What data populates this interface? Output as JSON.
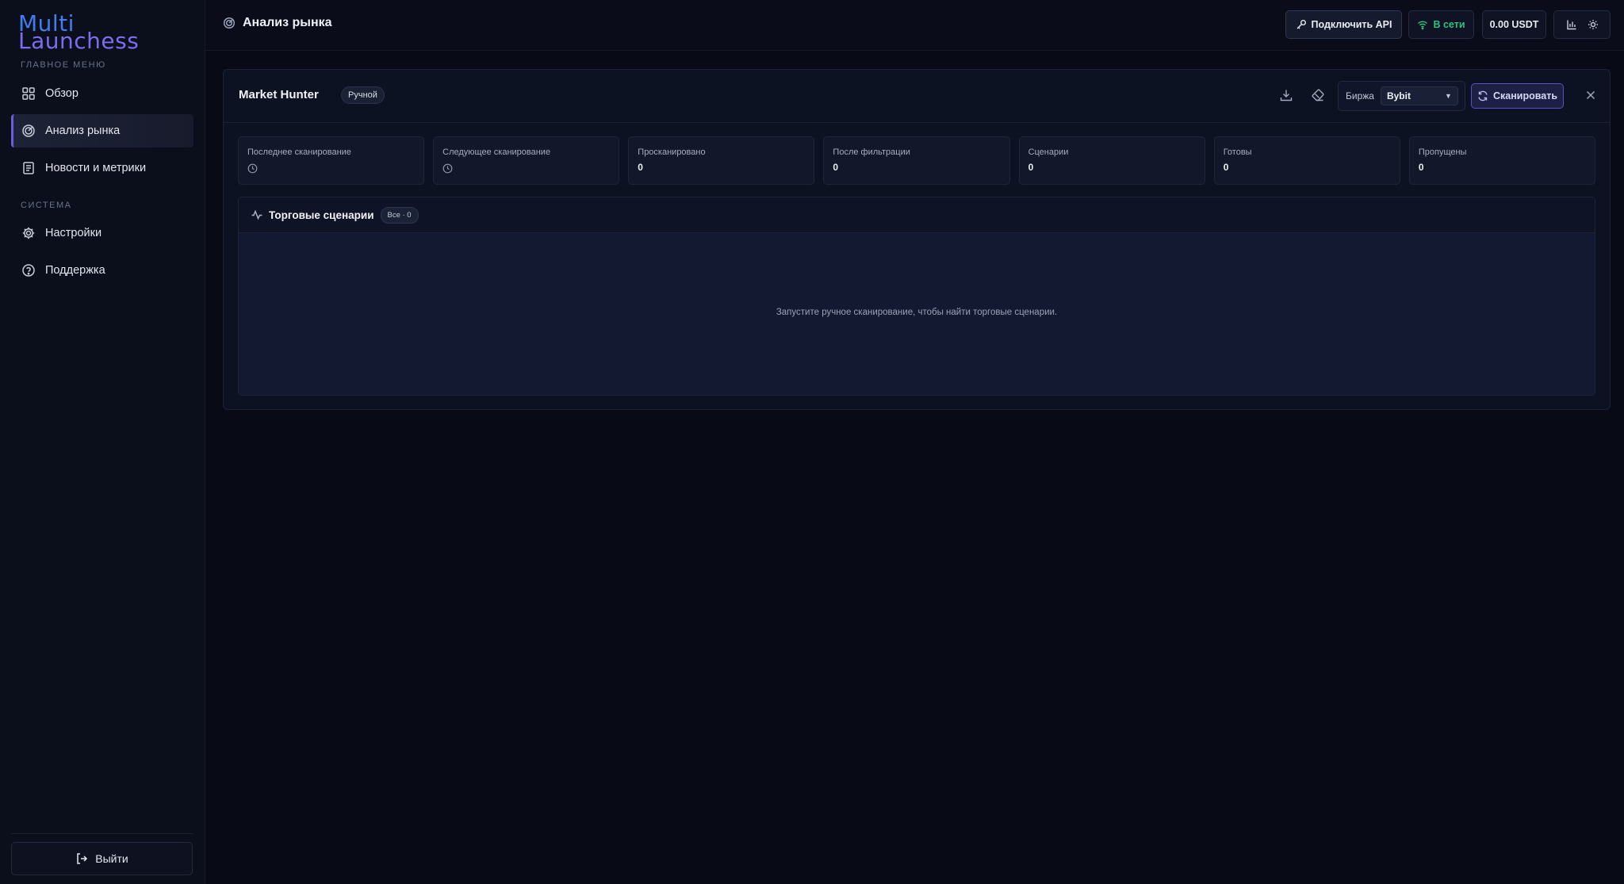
{
  "brand": {
    "line1": "Multi",
    "line2": "Launchess",
    "color1": "#3f7df0",
    "color2": "#7e6cf0"
  },
  "sidebar": {
    "main_label": "ГЛАВНОЕ МЕНЮ",
    "system_label": "СИСТЕМА",
    "items": [
      {
        "label": "Обзор",
        "icon": "grid-icon"
      },
      {
        "label": "Анализ рынка",
        "icon": "radar-icon",
        "active": true
      },
      {
        "label": "Новости и метрики",
        "icon": "newspaper-icon"
      },
      {
        "label": "Настройки",
        "icon": "gear-icon"
      },
      {
        "label": "Поддержка",
        "icon": "help-circle-icon"
      }
    ],
    "logout_label": "Выйти"
  },
  "header": {
    "title": "Анализ рынка",
    "api_button": "Подключить API",
    "status": "В сети",
    "balance": "0.00 USDT"
  },
  "panel": {
    "title": "Market Hunter",
    "mode": "Ручной",
    "exchange_label": "Биржа",
    "exchange_value": "Bybit",
    "scan_button": "Сканировать",
    "stats": [
      {
        "label": "Последнее сканирование",
        "value": ""
      },
      {
        "label": "Следующее сканирование",
        "value": ""
      },
      {
        "label": "Просканировано",
        "value": "0"
      },
      {
        "label": "После фильтрации",
        "value": "0"
      },
      {
        "label": "Сценарии",
        "value": "0"
      },
      {
        "label": "Готовы",
        "value": "0"
      },
      {
        "label": "Пропущены",
        "value": "0"
      }
    ],
    "scenarios": {
      "title": "Торговые сценарии",
      "badge": "Все · 0",
      "empty_text": "Запустите ручное сканирование, чтобы найти торговые сценарии."
    }
  },
  "colors": {
    "accent": "#6d5dd8",
    "online": "#2ec27e",
    "background": "#080b16"
  }
}
